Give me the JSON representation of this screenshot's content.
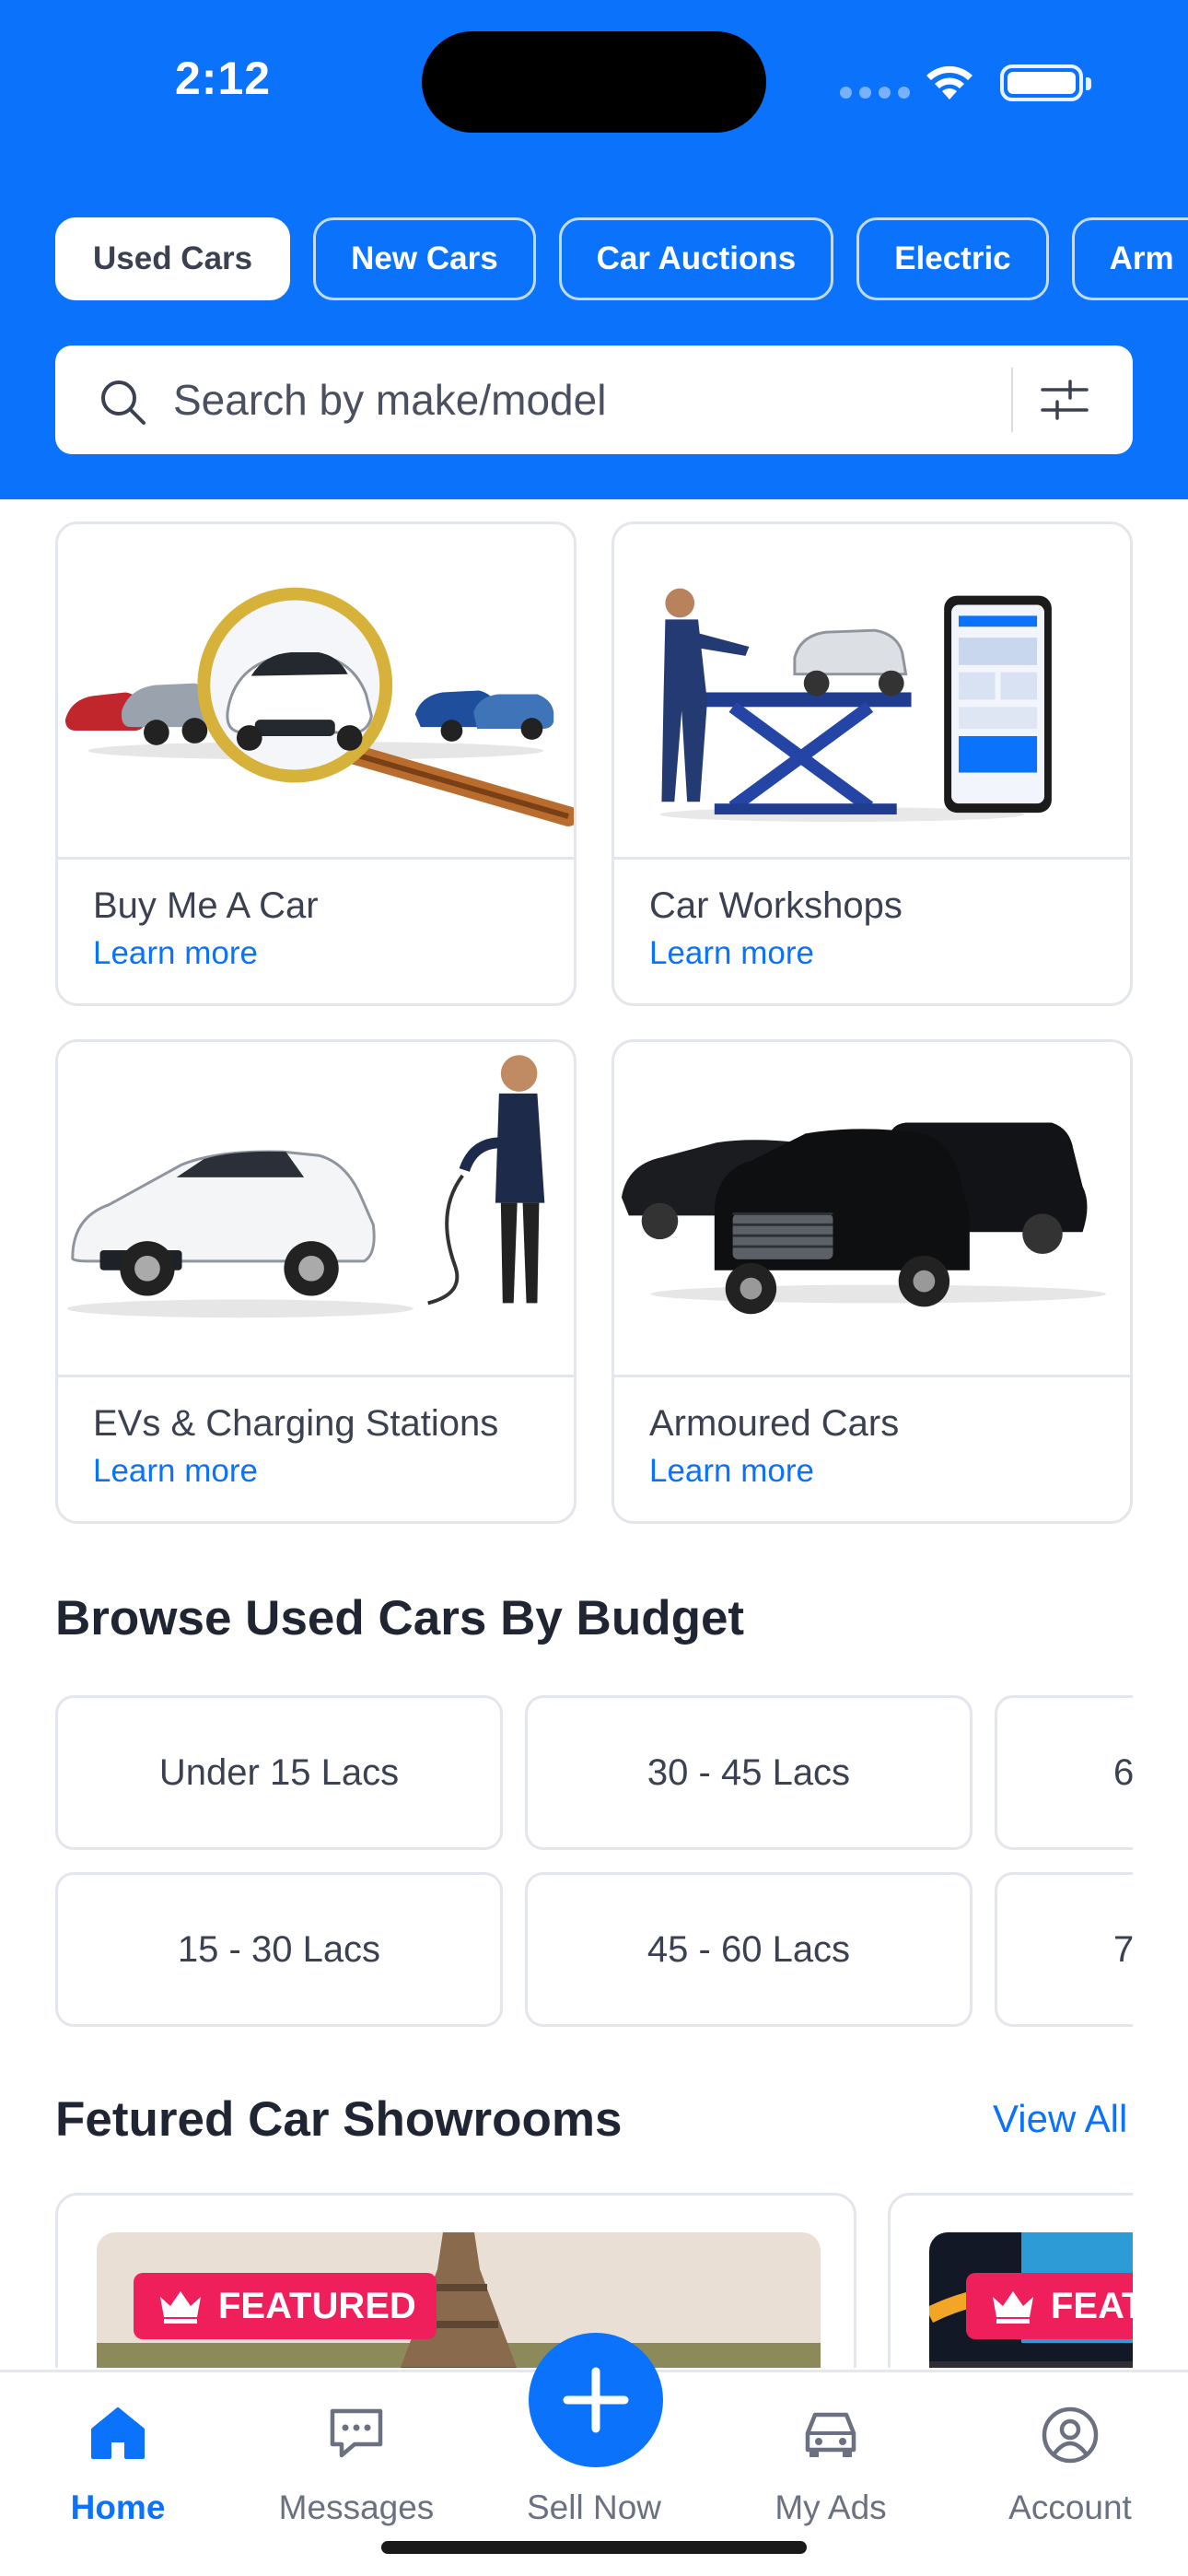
{
  "status_bar": {
    "time": "2:12"
  },
  "tabs": [
    {
      "label": "Used Cars",
      "active": true
    },
    {
      "label": "New Cars"
    },
    {
      "label": "Car Auctions"
    },
    {
      "label": "Electric"
    },
    {
      "label": "Arm"
    }
  ],
  "search": {
    "placeholder": "Search by make/model"
  },
  "services": [
    {
      "title": "Buy Me A Car",
      "link": "Learn more"
    },
    {
      "title": "Car Workshops",
      "link": "Learn more"
    },
    {
      "title": "EVs & Charging Stations",
      "link": "Learn more"
    },
    {
      "title": "Armoured Cars",
      "link": "Learn more"
    }
  ],
  "budget_section": {
    "title": "Browse Used Cars By Budget",
    "items": [
      "Under 15 Lacs",
      "30 - 45 Lacs",
      "6",
      "15 - 30 Lacs",
      "45 - 60 Lacs",
      "7"
    ]
  },
  "showrooms_section": {
    "title": "Fetured Car Showrooms",
    "view_all": "View All",
    "badge": "FEATURED",
    "badge_partial": "FEAT"
  },
  "bottom_nav": [
    {
      "label": "Home",
      "icon": "home-icon",
      "active": true
    },
    {
      "label": "Messages",
      "icon": "message-icon"
    },
    {
      "label": "Sell Now",
      "icon": "plus-icon"
    },
    {
      "label": "My Ads",
      "icon": "car-icon"
    },
    {
      "label": "Account",
      "icon": "user-icon"
    }
  ],
  "colors": {
    "primary": "#0a72fb",
    "badge": "#ee1f5b",
    "text": "#1f2533"
  }
}
